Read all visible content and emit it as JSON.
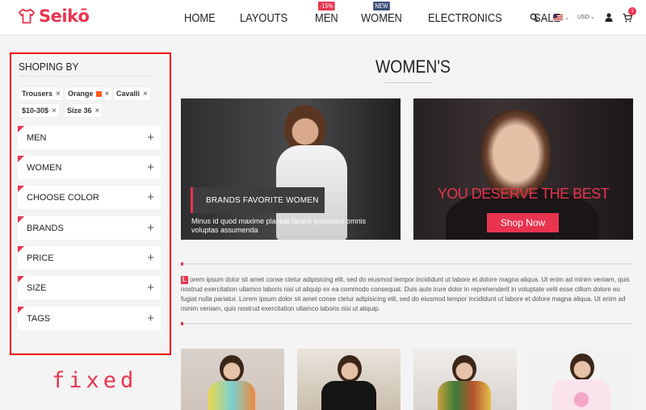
{
  "header": {
    "brand": "Seikō",
    "nav": [
      {
        "label": "HOME"
      },
      {
        "label": "LAYOUTS"
      },
      {
        "label": "MEN",
        "badge": "-15%",
        "badge_color": "#e8344f"
      },
      {
        "label": "WOMEN",
        "badge": "NEW",
        "badge_color": "#3b4d7a"
      },
      {
        "label": "ELECTRONICS"
      },
      {
        "label": "SALE"
      }
    ],
    "currency": "USD",
    "cart_count": "1",
    "icons": [
      "search-icon",
      "flag-us-icon",
      "user-icon",
      "cart-icon"
    ]
  },
  "sidebar": {
    "title": "SHOPING BY",
    "chips": [
      {
        "label": "Trousers"
      },
      {
        "label": "Orange",
        "swatch": "#ff5b1a"
      },
      {
        "label": "Cavalli"
      },
      {
        "label": "$10-30$"
      },
      {
        "label": "Size 36"
      }
    ],
    "filters": [
      "MEN",
      "WOMEN",
      "CHOOSE COLOR",
      "BRANDS",
      "PRICE",
      "SIZE",
      "TAGS"
    ]
  },
  "annotation": "fixed",
  "main": {
    "title": "WOMEN'S",
    "banner_left": {
      "tag": "BRANDS FAVORITE WOMEN",
      "caption": "Minus id quod maxime placeat facere possimus omnis voluptas assumenda"
    },
    "banner_right": {
      "headline": "YOU DESERVE THE BEST",
      "button": "Shop Now"
    },
    "paragraph_dropcap": "L",
    "paragraph": "orem ipsum dolor sit amet conse ctetur adipisicing elit, sed do eiusmod tempor incididunt ut labore et dolore magna aliqua. Ut enim ad minim veniam, quis nostrud exercitation ullamco laboris nisi ut aliquip ex ea commodo consequat. Duis aute irure dolor in reprehenderit in voluptate velit esse cillum dolore eu fugiat nulla pariatur. Lorem ipsum dolor sit amet conse ctetur adipisicing elit, sed do eiusmod tempor incididunt ut labore et dolore magna aliqua. Ut enim ad minim veniam, quis nostrud exercitation ullamco laboris nisi ut aliquip."
  },
  "colors": {
    "accent": "#e8344f",
    "annotation_border": "#e00000"
  }
}
